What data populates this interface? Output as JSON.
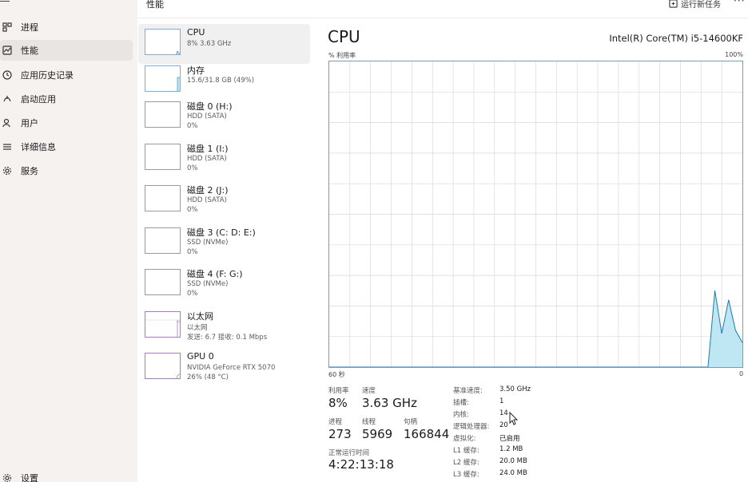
{
  "header": {
    "title": "性能",
    "run_task": "运行新任务",
    "more": "···"
  },
  "sidebar": {
    "items": [
      {
        "label": "进程",
        "icon": "processes-icon"
      },
      {
        "label": "性能",
        "icon": "performance-icon",
        "active": true
      },
      {
        "label": "应用历史记录",
        "icon": "history-icon"
      },
      {
        "label": "启动应用",
        "icon": "startup-icon"
      },
      {
        "label": "用户",
        "icon": "users-icon"
      },
      {
        "label": "详细信息",
        "icon": "details-icon"
      },
      {
        "label": "服务",
        "icon": "services-icon"
      }
    ],
    "settings": "设置"
  },
  "devices": [
    {
      "name": "CPU",
      "sub1": "8% 3.63 GHz",
      "sub2": ""
    },
    {
      "name": "内存",
      "sub1": "15.6/31.8 GB (49%)",
      "sub2": ""
    },
    {
      "name": "磁盘 0 (H:)",
      "sub1": "HDD (SATA)",
      "sub2": "0%"
    },
    {
      "name": "磁盘 1 (I:)",
      "sub1": "HDD (SATA)",
      "sub2": "0%"
    },
    {
      "name": "磁盘 2 (J:)",
      "sub1": "HDD (SATA)",
      "sub2": "0%"
    },
    {
      "name": "磁盘 3 (C: D: E:)",
      "sub1": "SSD (NVMe)",
      "sub2": "0%"
    },
    {
      "name": "磁盘 4 (F: G:)",
      "sub1": "SSD (NVMe)",
      "sub2": "0%"
    },
    {
      "name": "以太网",
      "sub1": "以太网",
      "sub2": "发送: 6.7 接收: 0.1 Mbps"
    },
    {
      "name": "GPU 0",
      "sub1": "NVIDIA GeForce RTX 5070",
      "sub2": "26% (48 °C)"
    }
  ],
  "main": {
    "title": "CPU",
    "model": "Intel(R) Core(TM) i5-14600KF",
    "graph_top_left": "% 利用率",
    "graph_top_right": "100%",
    "graph_bottom_left": "60 秒",
    "graph_bottom_right": "0"
  },
  "stats": {
    "utilization_label": "利用率",
    "utilization": "8%",
    "speed_label": "速度",
    "speed": "3.63 GHz",
    "processes_label": "进程",
    "processes": "273",
    "threads_label": "线程",
    "threads": "5969",
    "handles_label": "句柄",
    "handles": "166844",
    "uptime_label": "正常运行时间",
    "uptime": "4:22:13:18"
  },
  "specs": [
    {
      "label": "基准速度:",
      "value": "3.50 GHz"
    },
    {
      "label": "插槽:",
      "value": "1"
    },
    {
      "label": "内核:",
      "value": "14"
    },
    {
      "label": "逻辑处理器:",
      "value": "20"
    },
    {
      "label": "虚拟化:",
      "value": "已启用"
    },
    {
      "label": "L1 缓存:",
      "value": "1.2 MB"
    },
    {
      "label": "L2 缓存:",
      "value": "20.0 MB"
    },
    {
      "label": "L3 缓存:",
      "value": "24.0 MB"
    }
  ],
  "chart_data": {
    "type": "area",
    "ylabel": "% 利用率",
    "ylim": [
      0,
      100
    ],
    "xlim": [
      60,
      0
    ],
    "x": [
      60,
      49,
      48,
      47,
      46,
      45,
      44,
      43,
      42,
      41,
      40,
      39,
      38,
      37,
      36,
      35,
      34,
      33,
      32,
      31,
      30,
      29,
      28,
      27,
      26,
      25,
      24,
      23,
      22,
      21,
      20,
      19,
      18,
      17,
      16,
      15,
      14,
      13,
      12,
      11,
      10,
      9,
      8,
      7,
      6,
      5,
      4,
      3,
      2,
      1,
      0
    ],
    "values": [
      0,
      0,
      0,
      0,
      0,
      0,
      0,
      0,
      0,
      0,
      0,
      0,
      0,
      0,
      0,
      0,
      0,
      0,
      0,
      0,
      0,
      0,
      0,
      0,
      0,
      0,
      0,
      0,
      0,
      0,
      0,
      0,
      0,
      0,
      0,
      0,
      0,
      0,
      0,
      0,
      0,
      0,
      0,
      0,
      0,
      0,
      25,
      11,
      22,
      12,
      8
    ],
    "colors": {
      "line": "#1c7ab0",
      "fill": "#bfe6f3",
      "grid": "#d9d9d9"
    },
    "grid": true
  }
}
